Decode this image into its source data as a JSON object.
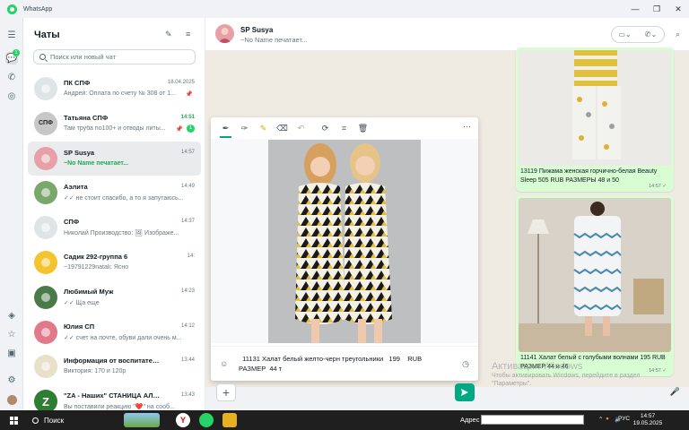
{
  "app": {
    "title": "WhatsApp"
  },
  "window_controls": {
    "minimize": "—",
    "restore": "❐",
    "close": "✕"
  },
  "rail": {
    "chats_badge": "1"
  },
  "sidebar": {
    "title": "Чаты",
    "search_placeholder": "Поиск или новый чат",
    "chats": [
      {
        "name": "ПК СПФ",
        "time": "18.04.2025",
        "msg": "Андрей: Оплата по счету № 308 от 1...",
        "pinned": true,
        "avatar_color": "#dfe5e7"
      },
      {
        "name": "Татьяна СПФ",
        "time": "14:51",
        "msg": "Там труба по100+ и отводы литы...",
        "unread": "1",
        "pinned": true,
        "avatar_color": "#c7c7c7",
        "avatar_text": "СПФ"
      },
      {
        "name": "SP Susya",
        "time": "14:57",
        "msg": "~No Name печатает...",
        "typing": true,
        "selected": true,
        "avatar_color": "#e8a0a8"
      },
      {
        "name": "Аэлита",
        "time": "14:49",
        "msg": "✓✓ не стоит спасибо, а то я запутаюсь...",
        "avatar_color": "#7aa86a"
      },
      {
        "name": "СПФ",
        "time": "14:37",
        "msg": "Николай Производство: 🖼 Изображе...",
        "avatar_color": "#dfe5e7"
      },
      {
        "name": "Садик 292-группа 6",
        "time": "14:",
        "msg": "~19791229natali: Ясно",
        "avatar_color": "#f4c430"
      },
      {
        "name": "Любимый Муж",
        "time": "14:23",
        "msg": "✓✓ Ща еще",
        "avatar_color": "#4a7a4a"
      },
      {
        "name": "Юлия СП",
        "time": "14:12",
        "msg": "✓✓ счет на почте, обуви дали очень м...",
        "avatar_color": "#e07a8a"
      },
      {
        "name": "Информация от воспитателей...",
        "time": "13:44",
        "msg": "Виктория: 170 и 120р",
        "avatar_color": "#e8e0c8"
      },
      {
        "name": "\"ZA - Наших\" СТАНИЦА АЛЕКС...",
        "time": "13:43",
        "msg": "Вы поставили реакцию \"❤️\" на сооб...",
        "avatar_color": "#2e7d32",
        "avatar_text": "Z"
      }
    ]
  },
  "conversation": {
    "name": "SP Susya",
    "status": "~No Name печатает...",
    "bubbles": [
      {
        "caption": "13119 Пижама женская горчично-белая Beauty Sleep    505    RUB    РАЗМЕРЫ   48 и 50",
        "time": "14:57 ✓"
      },
      {
        "caption": "11141 Халат белый с голубыми волнами    195    RUB  РАЗМЕР  44 и 46",
        "time": "14:57 ✓"
      }
    ]
  },
  "editor": {
    "caption": "  11131 Халат белый желто-черн треугольники   199    RUB\nРАЗМЕР  44 т"
  },
  "activate_windows": {
    "line1": "Активация Windows",
    "line2": "Чтобы активировать Windows, перейдите в раздел \"Параметры\"."
  },
  "taskbar": {
    "search_label": "Поиск",
    "address_label": "Адрес",
    "lang": "РУС",
    "time": "14:57",
    "date": "19.05.2025"
  },
  "colors": {
    "accent": "#00a884",
    "bubble": "#d9fdd3",
    "unread": "#25d366"
  }
}
